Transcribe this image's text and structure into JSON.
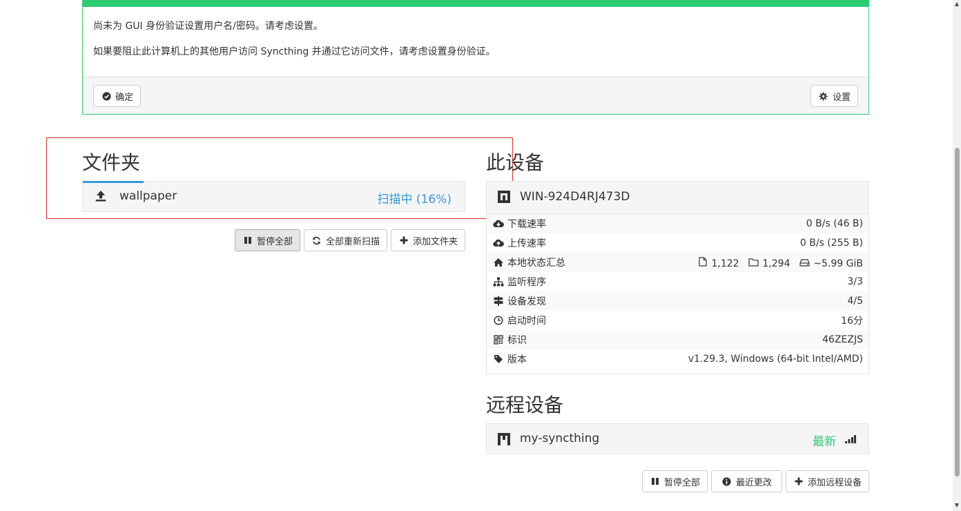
{
  "notice": {
    "line1": "尚未为 GUI 身份验证设置用户名/密码。请考虑设置。",
    "line2": "如果要阻止此计算机上的其他用户访问 Syncthing 并通过它访问文件，请考虑设置身份验证。",
    "ok_label": "确定",
    "settings_label": "设置",
    "accent_color": "#2ecc71"
  },
  "folders": {
    "heading": "文件夹",
    "items": [
      {
        "name": "wallpaper",
        "status": "扫描中 (16%)",
        "progress_percent": 16
      }
    ],
    "actions": {
      "pause_all": "暂停全部",
      "rescan_all": "全部重新扫描",
      "add_folder": "添加文件夹"
    }
  },
  "this_device": {
    "heading": "此设备",
    "name": "WIN-924D4RJ473D",
    "rows": {
      "download_rate": {
        "label": "下载速率",
        "value": "0 B/s (46 B)"
      },
      "upload_rate": {
        "label": "上传速率",
        "value": "0 B/s (255 B)"
      },
      "local_state": {
        "label": "本地状态汇总",
        "files": "1,122",
        "dirs": "1,294",
        "size": "~5.99 GiB"
      },
      "listeners": {
        "label": "监听程序",
        "value": "3/3"
      },
      "discovery": {
        "label": "设备发现",
        "value": "4/5"
      },
      "uptime": {
        "label": "启动时间",
        "value": "16分"
      },
      "identification": {
        "label": "标识",
        "value": "46ZEZJS"
      },
      "version": {
        "label": "版本",
        "value": "v1.29.3, Windows (64-bit Intel/AMD)"
      }
    }
  },
  "remote_devices": {
    "heading": "远程设备",
    "items": [
      {
        "name": "my-syncthing",
        "status": "最新"
      }
    ],
    "actions": {
      "pause_all": "暂停全部",
      "recent_changes": "最近更改",
      "add_remote": "添加远程设备"
    }
  },
  "colors": {
    "green": "#2ecc71",
    "blue": "#3498db",
    "highlight": "#d9302c"
  }
}
